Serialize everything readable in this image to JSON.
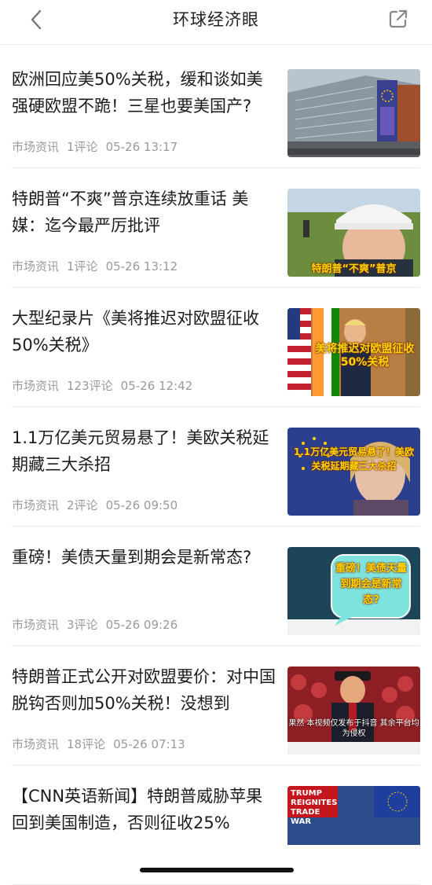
{
  "header": {
    "title": "环球经济眼",
    "back_icon": "chevron-left-icon",
    "share_icon": "share-icon"
  },
  "articles": [
    {
      "title": "欧洲回应美50%关税，缓和谈如美强硬欧盟不跪！三星也要美国产?",
      "source": "市场资讯",
      "comments": "1评论",
      "time": "05-26 13:17",
      "thumb_caption": ""
    },
    {
      "title": "特朗普“不爽”普京连续放重话 美媒：迄今最严厉批评",
      "source": "市场资讯",
      "comments": "1评论",
      "time": "05-26 13:12",
      "thumb_caption": "特朗普“不爽”普京"
    },
    {
      "title": "大型纪录片《美将推迟对欧盟征收50%关税》",
      "source": "市场资讯",
      "comments": "123评论",
      "time": "05-26 12:42",
      "thumb_caption": "美将推迟对欧盟征收50%关税"
    },
    {
      "title": "1.1万亿美元贸易悬了！美欧关税延期藏三大杀招",
      "source": "市场资讯",
      "comments": "2评论",
      "time": "05-26 09:50",
      "thumb_caption": "1.1万亿美元贸易悬了！美欧关税延期藏三大杀招"
    },
    {
      "title": "重磅！美债天量到期会是新常态?",
      "source": "市场资讯",
      "comments": "3评论",
      "time": "05-26 09:26",
      "thumb_caption": "重磅！美债天量到期会是新常态?"
    },
    {
      "title": "特朗普正式公开对欧盟要价：对中国脱钩否则加50%关税！没想到",
      "source": "市场资讯",
      "comments": "18评论",
      "time": "05-26 07:13",
      "thumb_caption": "果然 本视频仅发布于抖音 其余平台均为侵权"
    },
    {
      "title": "【CNN英语新闻】特朗普威胁苹果回到美国制造，否则征收25%",
      "source": "",
      "comments": "",
      "time": "",
      "thumb_caption": "TRUMP REIGNITES TRADE WAR"
    }
  ],
  "colors": {
    "text": "#1c1c1c",
    "meta": "#9a9a9a",
    "divider": "#ececec"
  }
}
